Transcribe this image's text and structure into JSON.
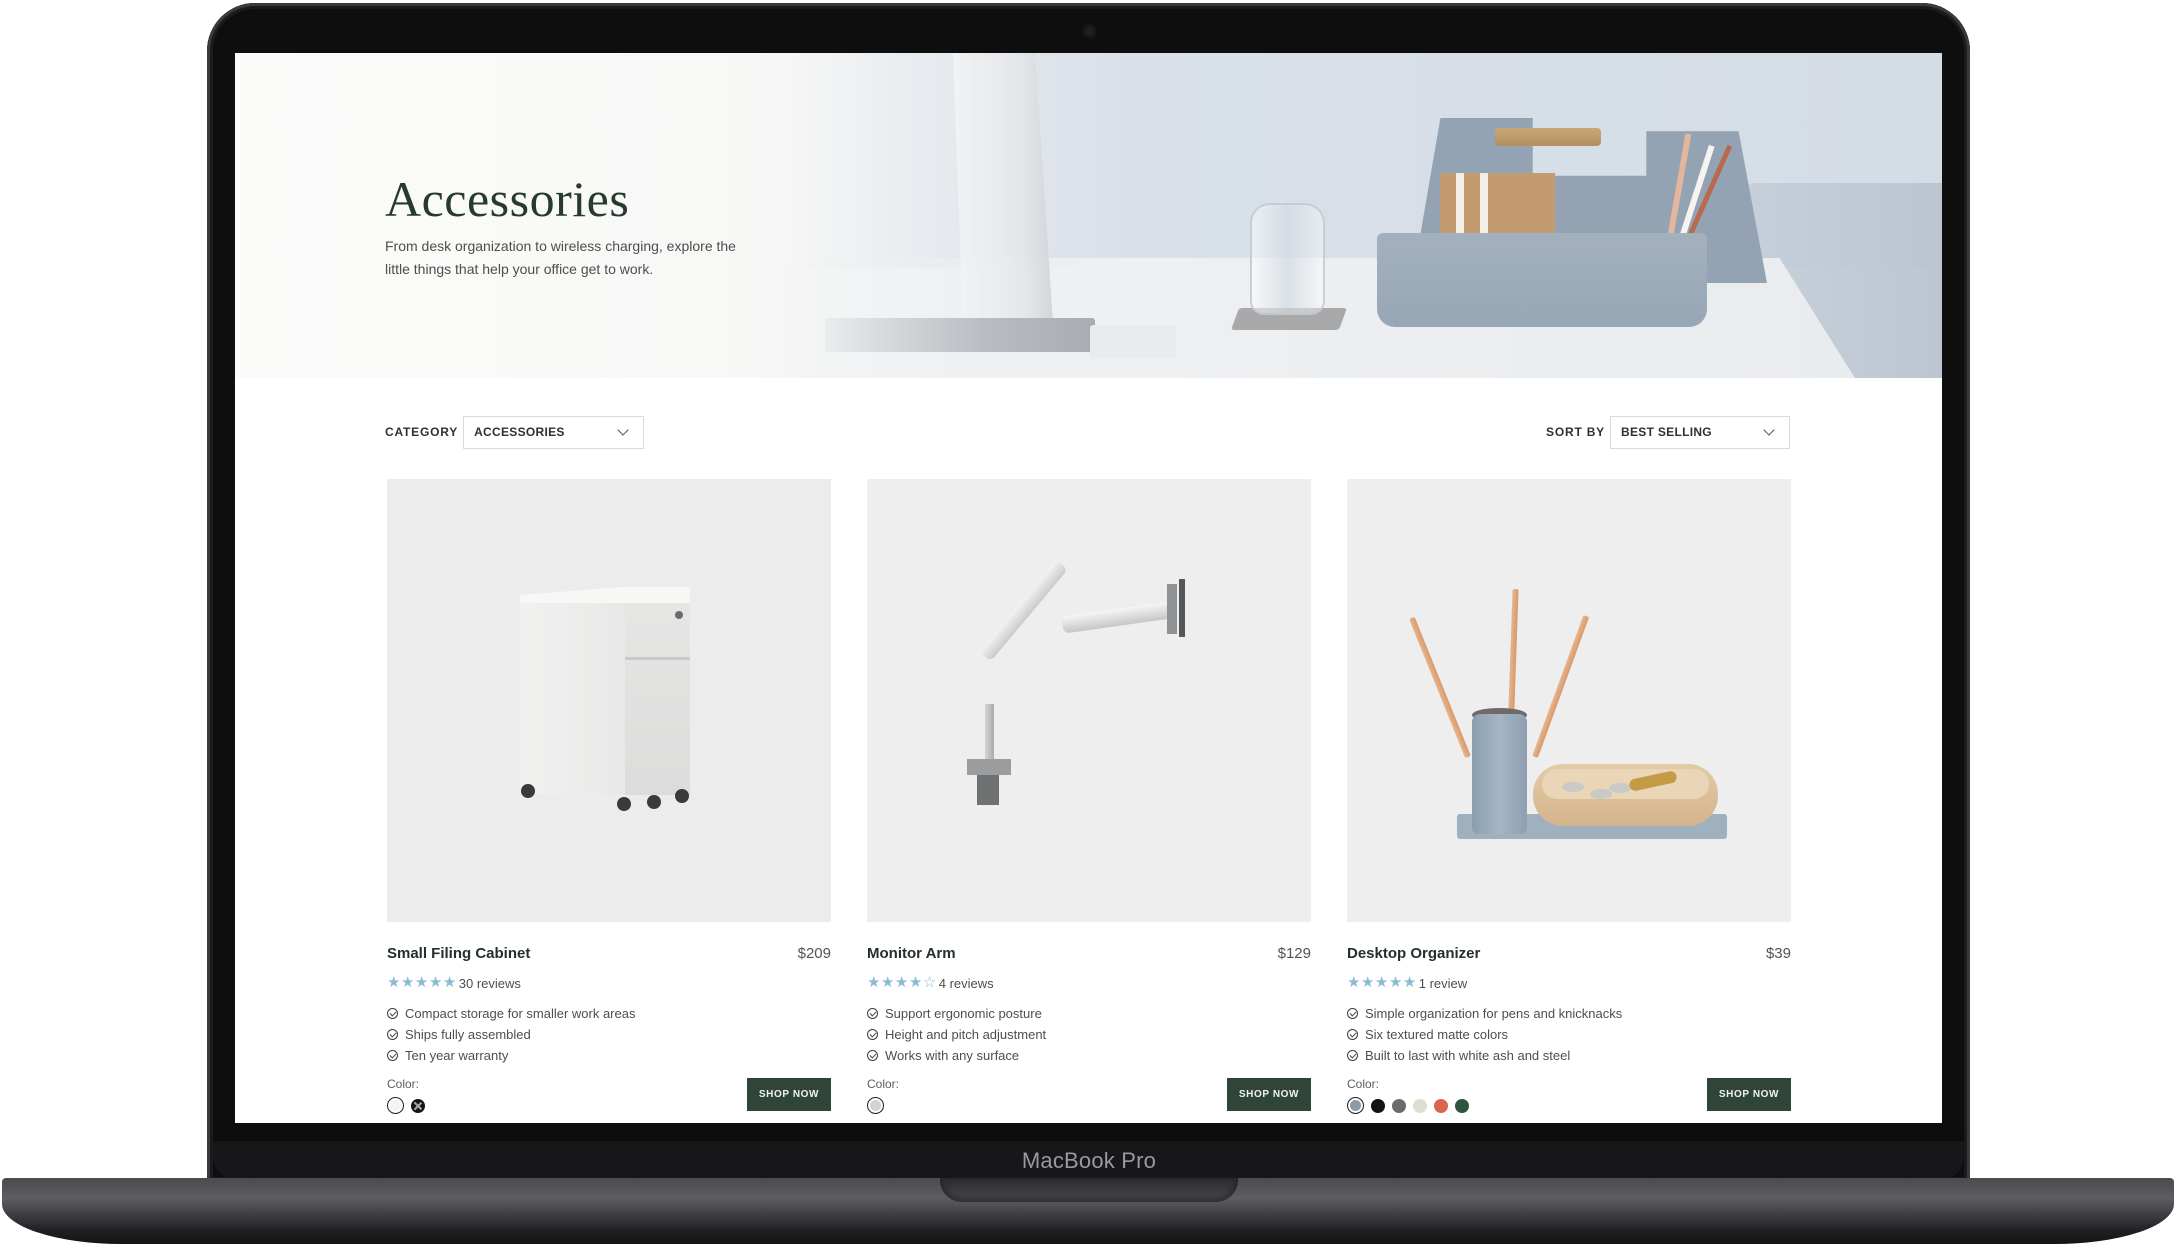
{
  "device": {
    "label": "MacBook Pro"
  },
  "hero": {
    "title": "Accessories",
    "description": "From desk organization to wireless charging, explore the little things that help your office get to work."
  },
  "filters": {
    "category": {
      "label": "CATEGORY",
      "value": "ACCESSORIES"
    },
    "sort": {
      "label": "SORT BY",
      "value": "BEST SELLING"
    }
  },
  "products": [
    {
      "name": "Small Filing Cabinet",
      "price": "$209",
      "rating": 5,
      "rating_max": 5,
      "reviews": "30 reviews",
      "features": [
        "Compact storage for smaller work areas",
        "Ships fully assembled",
        "Ten year warranty"
      ],
      "color_label": "Color:",
      "colors": [
        {
          "name": "white",
          "hex": "#f4f4f4",
          "selected": true
        },
        {
          "name": "black",
          "hex": "#151515",
          "selected": false,
          "crossed": true
        }
      ],
      "cta": "SHOP NOW"
    },
    {
      "name": "Monitor Arm",
      "price": "$129",
      "rating": 4,
      "rating_max": 5,
      "reviews": "4 reviews",
      "features": [
        "Support ergonomic posture",
        "Height and pitch adjustment",
        "Works with any surface"
      ],
      "color_label": "Color:",
      "colors": [
        {
          "name": "silver",
          "hex": "#d2d2d2",
          "selected": true
        }
      ],
      "cta": "SHOP NOW"
    },
    {
      "name": "Desktop Organizer",
      "price": "$39",
      "rating": 5,
      "rating_max": 5,
      "reviews": "1 review",
      "features": [
        "Simple organization for pens and knicknacks",
        "Six textured matte colors",
        "Built to last with white ash and steel"
      ],
      "color_label": "Color:",
      "colors": [
        {
          "name": "blue-gray",
          "hex": "#8e9aa6",
          "selected": true
        },
        {
          "name": "black",
          "hex": "#141414",
          "selected": false
        },
        {
          "name": "gray",
          "hex": "#6b6b6b",
          "selected": false
        },
        {
          "name": "cream",
          "hex": "#e0ddd3",
          "selected": false
        },
        {
          "name": "coral",
          "hex": "#d9654f",
          "selected": false
        },
        {
          "name": "green",
          "hex": "#2f5440",
          "selected": false
        }
      ],
      "cta": "SHOP NOW"
    }
  ],
  "colors": {
    "brand_green": "#2f4537",
    "star": "#88bccf",
    "text_dark": "#25302a"
  }
}
